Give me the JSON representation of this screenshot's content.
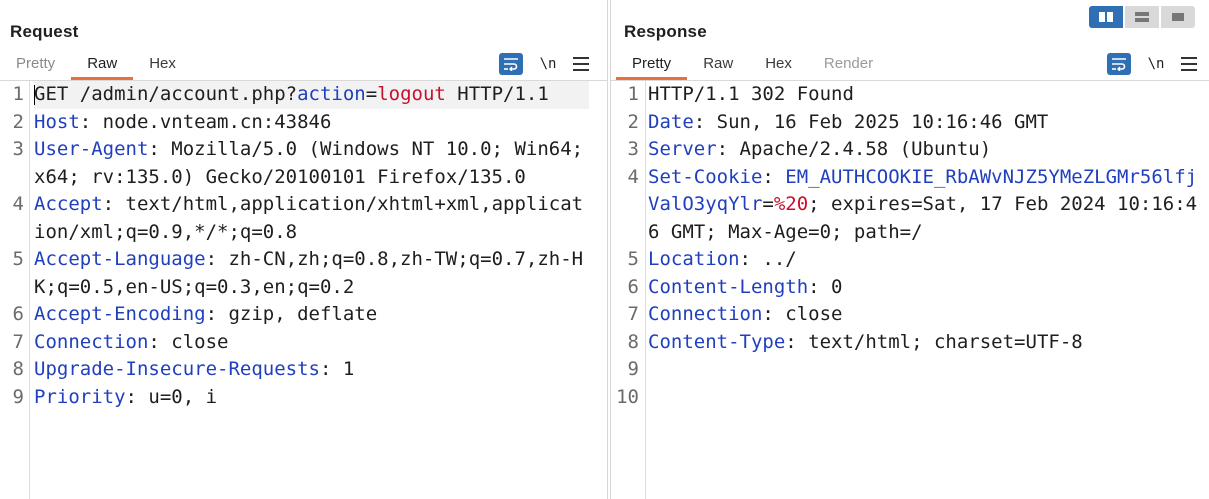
{
  "request": {
    "title": "Request",
    "tabs": [
      {
        "label": "Pretty",
        "state": "muted"
      },
      {
        "label": "Raw",
        "state": "active"
      },
      {
        "label": "Hex",
        "state": "normal"
      }
    ],
    "newline_label": "\\n",
    "lines": [
      {
        "n": "1",
        "parts": [
          [
            "v",
            "GET /admin/account.php?"
          ],
          [
            "k",
            "action"
          ],
          [
            "v",
            "="
          ],
          [
            "pv",
            "logout"
          ],
          [
            "v",
            " HTTP/1.1"
          ]
        ]
      },
      {
        "n": "2",
        "parts": [
          [
            "k",
            "Host"
          ],
          [
            "v",
            ": node.vnteam.cn:43846"
          ]
        ]
      },
      {
        "n": "3",
        "parts": [
          [
            "k",
            "User-Agent"
          ],
          [
            "v",
            ": Mozilla/5.0 (Windows NT 10.0; Win64; x64; rv:135.0) Gecko/20100101 Firefox/135.0"
          ]
        ]
      },
      {
        "n": "4",
        "parts": [
          [
            "k",
            "Accept"
          ],
          [
            "v",
            ": text/html,application/xhtml+xml,application/xml;q=0.9,*/*;q=0.8"
          ]
        ]
      },
      {
        "n": "5",
        "parts": [
          [
            "k",
            "Accept-Language"
          ],
          [
            "v",
            ": zh-CN,zh;q=0.8,zh-TW;q=0.7,zh-HK;q=0.5,en-US;q=0.3,en;q=0.2"
          ]
        ]
      },
      {
        "n": "6",
        "parts": [
          [
            "k",
            "Accept-Encoding"
          ],
          [
            "v",
            ": gzip, deflate"
          ]
        ]
      },
      {
        "n": "7",
        "parts": [
          [
            "k",
            "Connection"
          ],
          [
            "v",
            ": close"
          ]
        ]
      },
      {
        "n": "8",
        "parts": [
          [
            "k",
            "Upgrade-Insecure-Requests"
          ],
          [
            "v",
            ": 1"
          ]
        ]
      },
      {
        "n": "9",
        "parts": [
          [
            "k",
            "Priority"
          ],
          [
            "v",
            ": u=0, i"
          ]
        ]
      }
    ]
  },
  "response": {
    "title": "Response",
    "tabs": [
      {
        "label": "Pretty",
        "state": "active"
      },
      {
        "label": "Raw",
        "state": "normal"
      },
      {
        "label": "Hex",
        "state": "normal"
      },
      {
        "label": "Render",
        "state": "disabled"
      }
    ],
    "newline_label": "\\n",
    "lines": [
      {
        "n": "1",
        "parts": [
          [
            "v",
            "HTTP/1.1 302 Found"
          ]
        ]
      },
      {
        "n": "2",
        "parts": [
          [
            "k",
            "Date"
          ],
          [
            "v",
            ": Sun, 16 Feb 2025 10:16:46 GMT"
          ]
        ]
      },
      {
        "n": "3",
        "parts": [
          [
            "k",
            "Server"
          ],
          [
            "v",
            ": Apache/2.4.58 (Ubuntu)"
          ]
        ]
      },
      {
        "n": "4",
        "parts": [
          [
            "k",
            "Set-Cookie"
          ],
          [
            "v",
            ": "
          ],
          [
            "ck",
            "EM_AUTHCOOKIE_RbAWvNJZ5YMeZLGMr56lfjValO3yqYlr"
          ],
          [
            "v",
            "="
          ],
          [
            "pv",
            "%20"
          ],
          [
            "v",
            "; expires=Sat, 17 Feb 2024 10:16:46 GMT; Max-Age=0; path=/"
          ]
        ]
      },
      {
        "n": "5",
        "parts": [
          [
            "k",
            "Location"
          ],
          [
            "v",
            ": ../"
          ]
        ]
      },
      {
        "n": "6",
        "parts": [
          [
            "k",
            "Content-Length"
          ],
          [
            "v",
            ": 0"
          ]
        ]
      },
      {
        "n": "7",
        "parts": [
          [
            "k",
            "Connection"
          ],
          [
            "v",
            ": close"
          ]
        ]
      },
      {
        "n": "8",
        "parts": [
          [
            "k",
            "Content-Type"
          ],
          [
            "v",
            ": text/html; charset=UTF-8"
          ]
        ]
      },
      {
        "n": "9",
        "parts": []
      },
      {
        "n": "10",
        "parts": []
      }
    ]
  },
  "colors": {
    "accent_blue": "#2f6fb4",
    "tab_underline": "#e8703a",
    "header_key": "#1f3fbf",
    "param_value": "#c8102e"
  },
  "icons": [
    "layout-split-horizontal-icon",
    "layout-split-vertical-icon",
    "layout-tabs-icon",
    "word-wrap-icon",
    "newline-icon",
    "menu-icon"
  ]
}
